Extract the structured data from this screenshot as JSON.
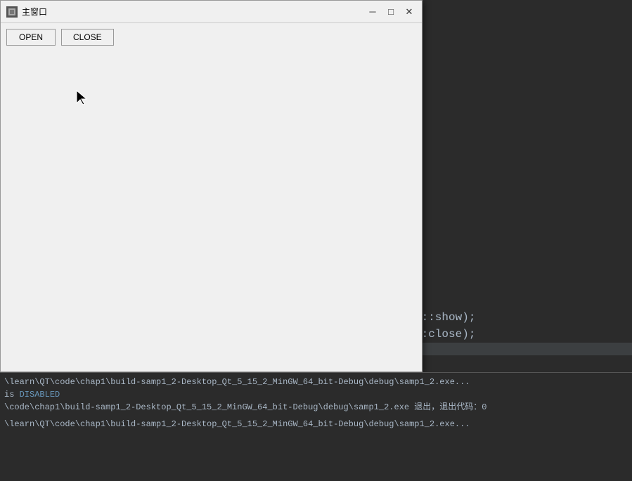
{
  "window": {
    "title": "主窗口",
    "title_icon": "■"
  },
  "titlebar": {
    "minimize_label": "─",
    "maximize_label": "□",
    "close_label": "✕"
  },
  "toolbar": {
    "open_label": "OPEN",
    "close_label": "CLOSE"
  },
  "code": {
    "line1": "t::show);",
    "line2": "::close);"
  },
  "output": {
    "line1": "\\learn\\QT\\code\\chap1\\build-samp1_2-Desktop_Qt_5_15_2_MinGW_64_bit-Debug\\debug\\samp1_2.exe...",
    "line2": "is DISABLED",
    "line3": "\\code\\chap1\\build-samp1_2-Desktop_Qt_5_15_2_MinGW_64_bit-Debug\\debug\\samp1_2.exe 退出，退出代码：0",
    "line4": "\\learn\\QT\\code\\chap1\\build-samp1_2-Desktop_Qt_5_15_2_MinGW_64_bit-Debug\\debug\\samp1_2.exe...",
    "disabled_keyword": "DISABLED",
    "exit_code": "0"
  },
  "colors": {
    "bg_dark": "#2b2b2b",
    "bg_light": "#f0f0f0",
    "code_default": "#a9b7c6",
    "code_keyword": "#cc7832",
    "output_path": "#a9b7c6",
    "output_disabled": "#6897bb",
    "border": "#999999"
  }
}
